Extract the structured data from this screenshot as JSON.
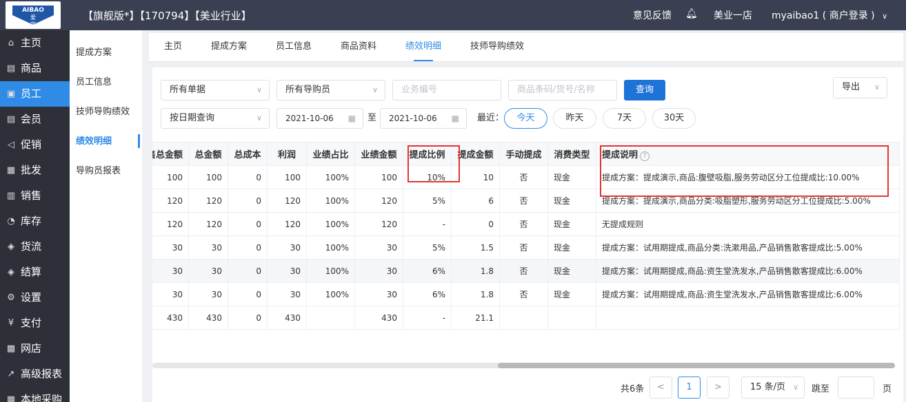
{
  "header": {
    "logo_top": "AIBAO",
    "logo_mid": "爱宝",
    "title": "【旗舰版*】【170794】【美业行业】",
    "feedback": "意见反馈",
    "bell_icon": "bell-icon",
    "store": "美业一店",
    "user": "myaibao1 ( 商户登录 )"
  },
  "sidebar": {
    "items": [
      {
        "label": "主页",
        "icon": "⌂"
      },
      {
        "label": "商品",
        "icon": "▤"
      },
      {
        "label": "员工",
        "icon": "▣"
      },
      {
        "label": "会员",
        "icon": "▤"
      },
      {
        "label": "促销",
        "icon": "◁"
      },
      {
        "label": "批发",
        "icon": "▦"
      },
      {
        "label": "销售",
        "icon": "▥"
      },
      {
        "label": "库存",
        "icon": "◔"
      },
      {
        "label": "货流",
        "icon": "◈"
      },
      {
        "label": "结算",
        "icon": "◈"
      },
      {
        "label": "设置",
        "icon": "⚙"
      },
      {
        "label": "支付",
        "icon": "¥"
      },
      {
        "label": "网店",
        "icon": "▩"
      },
      {
        "label": "高级报表",
        "icon": "↗"
      },
      {
        "label": "本地采购",
        "icon": "▦"
      }
    ]
  },
  "subnav": {
    "items": [
      "提成方案",
      "员工信息",
      "技师导购绩效",
      "绩效明细",
      "导购员报表"
    ]
  },
  "tabs": [
    "主页",
    "提成方案",
    "员工信息",
    "商品资料",
    "绩效明细",
    "技师导购绩效"
  ],
  "filters": {
    "order_type": "所有单据",
    "guide": "所有导购员",
    "biz_no_placeholder": "业务编号",
    "goods_placeholder": "商品条码/货号/名称",
    "query": "查询",
    "export": "导出",
    "date_mode": "按日期查询",
    "date_from": "2021-10-06",
    "to": "至",
    "date_to": "2021-10-06",
    "recent": "最近：",
    "quick": [
      "今天",
      "昨天",
      "7天",
      "30天"
    ]
  },
  "table": {
    "headers": [
      "零售总金额",
      "总金额",
      "总成本",
      "利润",
      "业绩占比",
      "业绩金额",
      "提成比例",
      "提成金额",
      "手动提成",
      "消费类型",
      "提成说明"
    ],
    "rows": [
      [
        "100",
        "100",
        "0",
        "100",
        "100%",
        "100",
        "10%",
        "10",
        "否",
        "现金",
        "提成方案：提成演示,商品:腹壁吸脂,服务劳动区分工位提成比:10.00%"
      ],
      [
        "120",
        "120",
        "0",
        "120",
        "100%",
        "120",
        "5%",
        "6",
        "否",
        "现金",
        "提成方案：提成演示,商品分类:吸脂塑形,服务劳动区分工位提成比:5.00%"
      ],
      [
        "120",
        "120",
        "0",
        "120",
        "100%",
        "120",
        "-",
        "0",
        "否",
        "现金",
        "无提成规则"
      ],
      [
        "30",
        "30",
        "0",
        "30",
        "100%",
        "30",
        "5%",
        "1.5",
        "否",
        "现金",
        "提成方案：试用期提成,商品分类:洗漱用品,产品销售散客提成比:5.00%"
      ],
      [
        "30",
        "30",
        "0",
        "30",
        "100%",
        "30",
        "6%",
        "1.8",
        "否",
        "现金",
        "提成方案：试用期提成,商品:资生堂洗发水,产品销售散客提成比:6.00%"
      ],
      [
        "30",
        "30",
        "0",
        "30",
        "100%",
        "30",
        "6%",
        "1.8",
        "否",
        "现金",
        "提成方案：试用期提成,商品:资生堂洗发水,产品销售散客提成比:6.00%"
      ],
      [
        "430",
        "430",
        "0",
        "430",
        "",
        "430",
        "-",
        "21.1",
        "",
        "",
        ""
      ]
    ]
  },
  "pagination": {
    "total": "共6条",
    "prev": "<",
    "page": "1",
    "next": ">",
    "size": "15 条/页",
    "goto": "跳至",
    "page_unit": "页"
  },
  "colors": {
    "accent": "#2f8be6",
    "highlight": "#e53333",
    "topbar": "#3a3f51",
    "sidebar": "#2d3038"
  }
}
